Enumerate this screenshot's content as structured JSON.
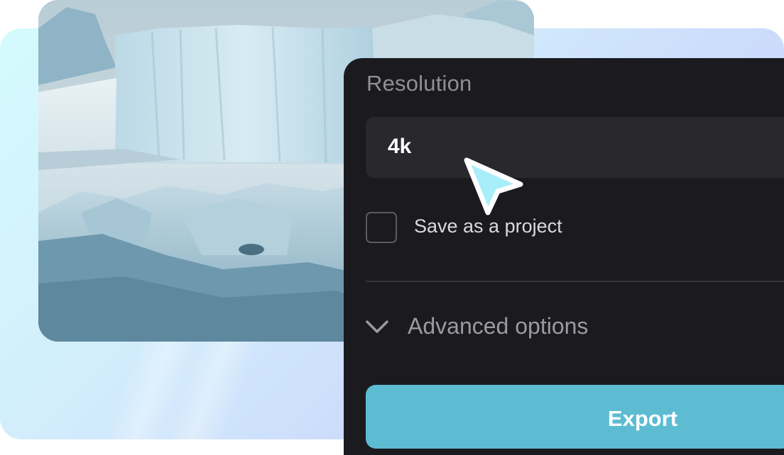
{
  "resolution": {
    "label": "Resolution",
    "value": "4k"
  },
  "save_project": {
    "label": "Save as a project",
    "checked": false
  },
  "advanced": {
    "label": "Advanced options",
    "icon": "chevron-down-icon"
  },
  "export": {
    "label": "Export"
  },
  "colors": {
    "panel_bg": "#1b1b1f",
    "field_bg": "#29292d",
    "accent": "#5dbcd2",
    "cursor": "#a8eefa"
  }
}
